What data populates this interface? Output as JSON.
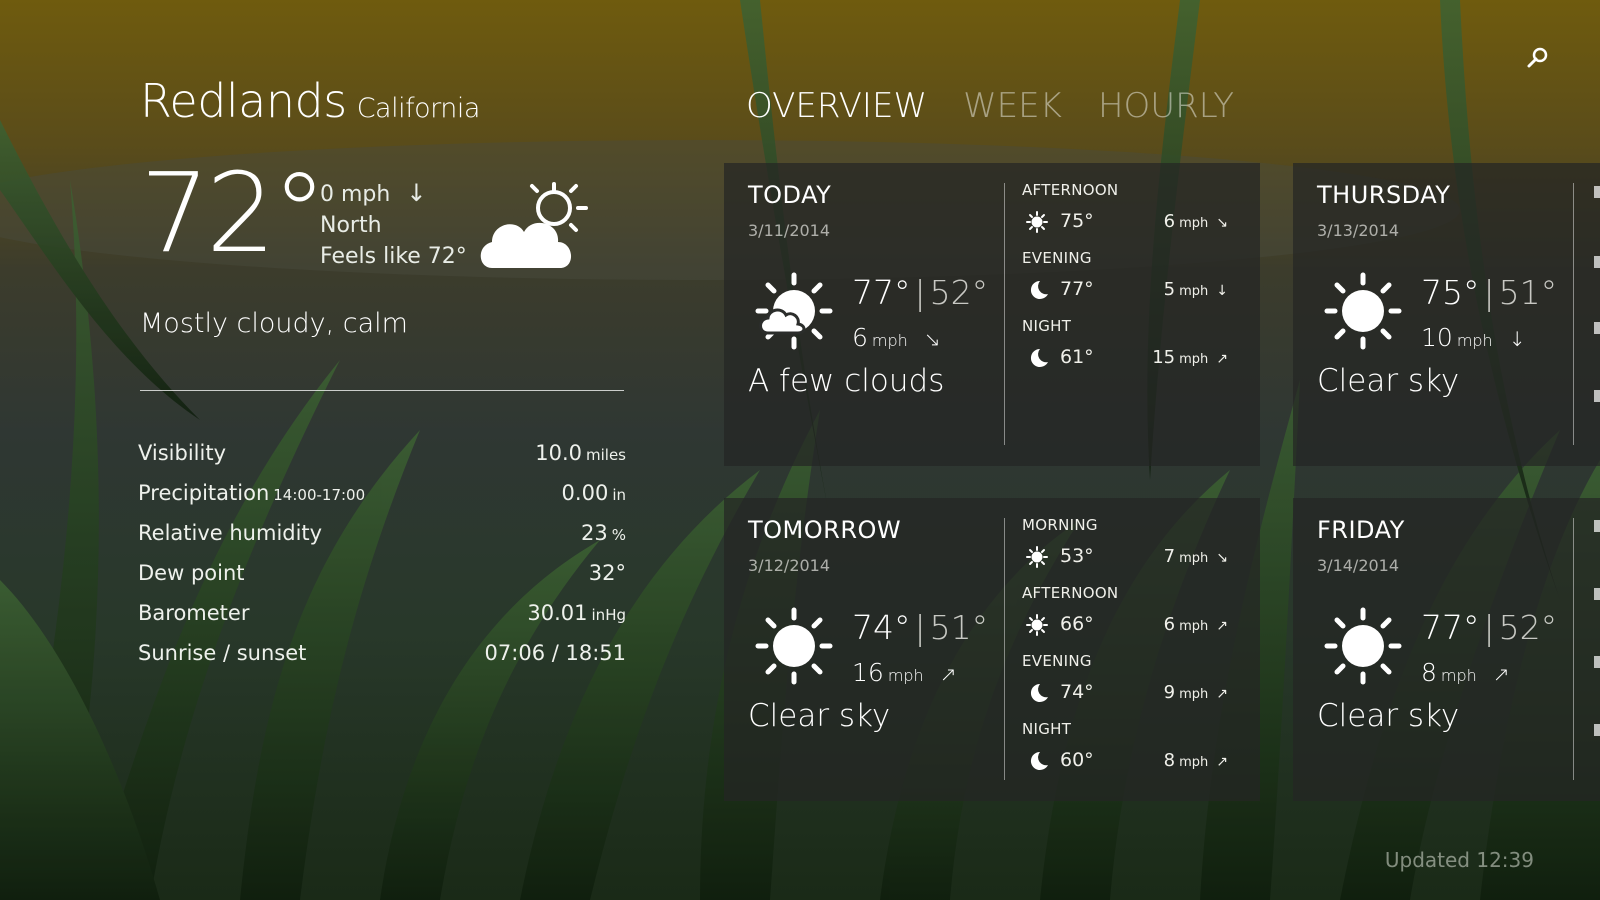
{
  "location": {
    "city": "Redlands",
    "state": "California"
  },
  "current": {
    "temperature": "72°",
    "wind_speed": "0 mph",
    "wind_direction": "North",
    "feels_like": "Feels like 72°",
    "condition": "Mostly cloudy, calm",
    "icon": "partly-cloudy-icon"
  },
  "details": [
    {
      "label": "Visibility",
      "sub": "",
      "value": "10.0",
      "unit": "miles"
    },
    {
      "label": "Precipitation",
      "sub": "14:00-17:00",
      "value": "0.00",
      "unit": "in"
    },
    {
      "label": "Relative humidity",
      "sub": "",
      "value": "23",
      "unit": "%"
    },
    {
      "label": "Dew point",
      "sub": "",
      "value": "32°",
      "unit": ""
    },
    {
      "label": "Barometer",
      "sub": "",
      "value": "30.01",
      "unit": "inHg"
    },
    {
      "label": "Sunrise / sunset",
      "sub": "",
      "value": "07:06 / 18:51",
      "unit": ""
    }
  ],
  "tabs": [
    {
      "label": "OVERVIEW",
      "active": true
    },
    {
      "label": "WEEK",
      "active": false
    },
    {
      "label": "HOURLY",
      "active": false
    }
  ],
  "cards": {
    "today": {
      "title": "TODAY",
      "date": "3/11/2014",
      "hi": "77°",
      "lo": "52°",
      "wind": "6",
      "wind_unit": "mph",
      "desc": "A few clouds",
      "icon": "partly-cloudy-icon",
      "periods": [
        {
          "label": "AFTERNOON",
          "icon": "sun-icon",
          "temp": "75°",
          "wind": "6",
          "unit": "mph"
        },
        {
          "label": "EVENING",
          "icon": "moon-icon",
          "temp": "77°",
          "wind": "5",
          "unit": "mph"
        },
        {
          "label": "NIGHT",
          "icon": "moon-icon",
          "temp": "61°",
          "wind": "15",
          "unit": "mph"
        }
      ]
    },
    "tomorrow": {
      "title": "TOMORROW",
      "date": "3/12/2014",
      "hi": "74°",
      "lo": "51°",
      "wind": "16",
      "wind_unit": "mph",
      "desc": "Clear sky",
      "icon": "sun-icon",
      "periods": [
        {
          "label": "MORNING",
          "icon": "sun-icon",
          "temp": "53°",
          "wind": "7",
          "unit": "mph"
        },
        {
          "label": "AFTERNOON",
          "icon": "sun-icon",
          "temp": "66°",
          "wind": "6",
          "unit": "mph"
        },
        {
          "label": "EVENING",
          "icon": "moon-icon",
          "temp": "74°",
          "wind": "9",
          "unit": "mph"
        },
        {
          "label": "NIGHT",
          "icon": "moon-icon",
          "temp": "60°",
          "wind": "8",
          "unit": "mph"
        }
      ]
    },
    "thursday": {
      "title": "THURSDAY",
      "date": "3/13/2014",
      "hi": "75°",
      "lo": "51°",
      "wind": "10",
      "wind_unit": "mph",
      "desc": "Clear sky",
      "icon": "sun-icon"
    },
    "friday": {
      "title": "FRIDAY",
      "date": "3/14/2014",
      "hi": "77°",
      "lo": "52°",
      "wind": "8",
      "wind_unit": "mph",
      "desc": "Clear sky",
      "icon": "sun-icon"
    }
  },
  "updated": "Updated 12:39",
  "colors": {
    "card_bg": "#262826",
    "sky_top": "#6b5a12",
    "grass": "#1f3a1c"
  }
}
